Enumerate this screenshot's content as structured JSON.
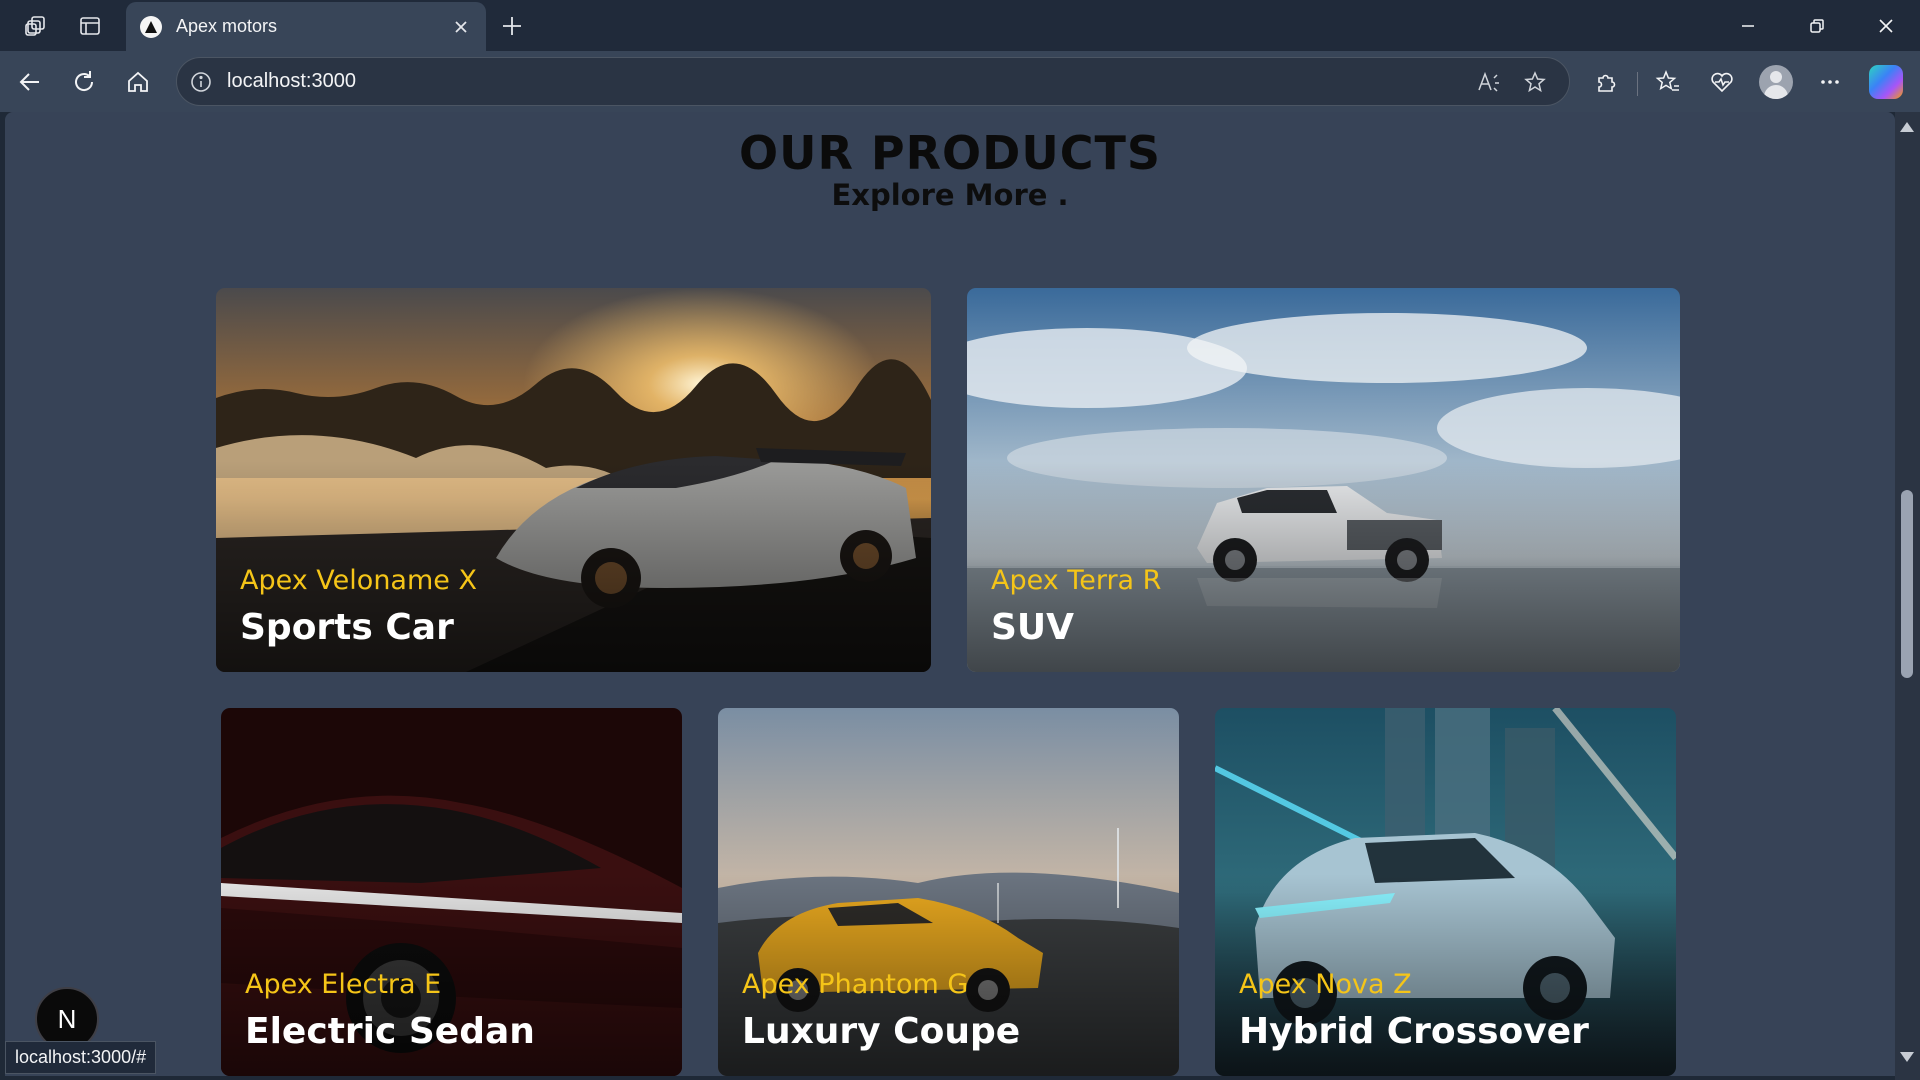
{
  "browser": {
    "tab_title": "Apex motors",
    "address": "localhost:3000",
    "status_url": "localhost:3000/#"
  },
  "page": {
    "heading": "OUR PRODUCTS",
    "subheading": "Explore More ."
  },
  "products": [
    {
      "model": "Apex Veloname X",
      "category": "Sports Car"
    },
    {
      "model": "Apex Terra R",
      "category": "SUV"
    },
    {
      "model": "Apex Electra E",
      "category": "Electric Sedan"
    },
    {
      "model": "Apex Phantom G",
      "category": "Luxury Coupe"
    },
    {
      "model": "Apex Nova Z",
      "category": "Hybrid Crossover"
    }
  ],
  "dev_badge": {
    "letter": "N"
  },
  "colors": {
    "page_bg": "#374357",
    "model_label": "#f5c518",
    "category_label": "#ffffff"
  }
}
